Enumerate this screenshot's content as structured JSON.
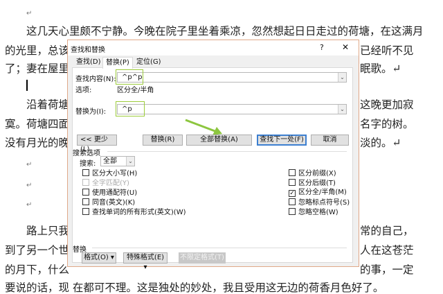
{
  "document": {
    "para_mark": "↵",
    "lines": [
      {
        "left": "这几天心里颇不宁静。今晚在院子里坐着乘凉，忽然想起日日走过的荷塘，在这满月",
        "right": ""
      },
      {
        "left": "的光里，总该",
        "right": "已经听不见"
      },
      {
        "left": "了；妻在屋里",
        "right": "眠歌。↵"
      },
      {
        "left": "沿着荷塘",
        "right": "这晚更加寂"
      },
      {
        "left": "寞。荷塘四面，",
        "right": "名字的树。"
      },
      {
        "left": "没有月光的晚",
        "right": "淡的。↵"
      },
      {
        "left": "路上只我",
        "right": "常的自己，"
      },
      {
        "left": "到了另一个世",
        "right": "人在这苍茫"
      },
      {
        "left": "的月下，什么",
        "right": "的事，一定"
      },
      {
        "left": "要说的话，现 在都可不理。这是独处的妙处，我且受用这无边的荷香月色好了。",
        "right": ""
      }
    ]
  },
  "dialog": {
    "title": "查找和替换",
    "help": "?",
    "close": "✕",
    "tabs": [
      "查找(D)",
      "替换(P)",
      "定位(G)"
    ],
    "active_tab": 1,
    "find_label": "查找内容(N):",
    "find_value": "^p^p",
    "options_label": "选项:",
    "options_value": "区分全/半角",
    "replace_label": "替换为(I):",
    "replace_value": "^p",
    "buttons": {
      "less": "<< 更少(L)",
      "replace": "替换(R)",
      "replace_all": "全部替换(A)",
      "find_next": "查找下一处(F)",
      "cancel": "取消"
    },
    "search_options_title": "搜索选项",
    "search_label": "搜索:",
    "search_value": "全部",
    "left_checks": [
      {
        "label": "区分大小写(H)",
        "checked": false,
        "disabled": false
      },
      {
        "label": "全字匹配(Y)",
        "checked": false,
        "disabled": true
      },
      {
        "label": "使用通配符(U)",
        "checked": false,
        "disabled": false
      },
      {
        "label": "同音(英文)(K)",
        "checked": false,
        "disabled": false
      },
      {
        "label": "查找单词的所有形式(英文)(W)",
        "checked": false,
        "disabled": false
      }
    ],
    "right_checks": [
      {
        "label": "区分前缀(X)",
        "checked": false
      },
      {
        "label": "区分后缀(T)",
        "checked": false
      },
      {
        "label": "区分全/半角(M)",
        "checked": true
      },
      {
        "label": "忽略标点符号(S)",
        "checked": false
      },
      {
        "label": "忽略空格(W)",
        "checked": false
      }
    ],
    "replace_section_title": "替换",
    "format_btn": "格式(O) ▾",
    "special_btn": "特殊格式(E) ▾",
    "noformat_btn": "不限定格式(T)"
  },
  "colors": {
    "highlight": "#9ccc3a",
    "arrow": "#8dc63f",
    "dialog_border": "#e0a888",
    "default_button": "#3c7fd0"
  }
}
